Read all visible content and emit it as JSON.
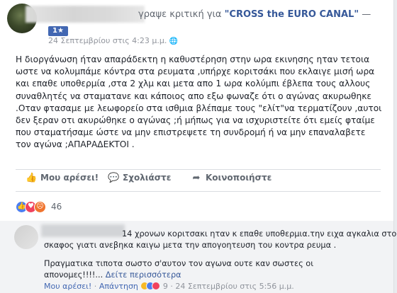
{
  "header": {
    "page_name": "\"CROSS the EURO CANAL\"",
    "action_text": "γραψε κριτική για ",
    "rest": " —",
    "badge": "1★",
    "timestamp": "24 Σεπτεμβρίου στις 4:23 μ.μ.",
    "privacy_icon": "globe-icon"
  },
  "post": {
    "lines": [
      "Η διοργάνωση ήταν απαράδεκτη η καθυστέρηση στην ωρα εκινησης ηταν τετοια",
      "ωστε να κολυμπάμε κόντρα στα ρευματα ,υπήρχε κοριτσάκι που εκλαιγε μισή ωρα",
      "και επαθε υποθερμία ,στα 2 χλμ και μετα απο 1 ωρα κολύμπι έβλεπα τους αλλους",
      "συναθλητές να σταματανε και κάποιος απο εξω φωναζε ότι ο αγώνας ακυρωθηκε",
      ".Οταν φτασαμε με λεωφορείο στα ισθμια βλέπαμε τους \"ελίτ\"να τερματίζουν ,αυτοι",
      "δεν ξεραν οτι ακυρώθηκε ο αγώνας ;ή μήπως για να ισχυριστείτε ότι εμείς φταίμε",
      "που σταματήσαμε ώστε να μην επιστρεψετε τη συνδρομή ή να μην επαναλαβετε",
      "τον αγώνα ;ΑΠΑΡΑΔΕΚΤΟΙ ."
    ]
  },
  "actions": {
    "like": "Μου αρέσει!",
    "comment": "Σχολιάστε",
    "share": "Κοινοποιήστε"
  },
  "reactions": {
    "count": "46"
  },
  "comment": {
    "lines": [
      "14 χρονων κοριτσακι ηταν κ επαθε υποθερμια.την ειχα αγκαλια στο",
      "σκαφος γιατι ανεβηκα καιγω μετα την απογοητευση του κοντρα ρευμα ."
    ],
    "second_lines": [
      "Πραγματικα τιποτα σωστο σ'αυτον τον αγωνα ουτε καν σωστες οι",
      "απονομες!!!!..."
    ],
    "see_more": "Δείτε περισσότερα",
    "like": "Μου αρέσει!",
    "reply": "Απάντηση",
    "sep": " · ",
    "reaction_count": "9",
    "timestamp": "24 Σεπτεμβρίου στις 5:56 μ.μ."
  },
  "colors": {
    "link": "#365899",
    "brand": "#4267b2",
    "meta": "#90949c"
  }
}
